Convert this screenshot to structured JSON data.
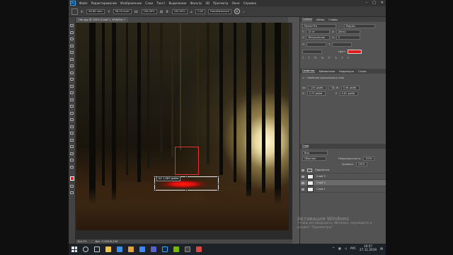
{
  "menu": {
    "items": [
      "Файл",
      "Редактирование",
      "Изображение",
      "Слои",
      "Текст",
      "Выделение",
      "Фильтр",
      "3D",
      "Просмотр",
      "Окно",
      "Справка"
    ]
  },
  "options": {
    "x": "48,86 пикс",
    "y": "96,04 пикс",
    "w": "100,00%",
    "h": "100,00%",
    "angle": "0,00",
    "interp": "Бикубическая"
  },
  "document": {
    "tab_label": "Лес.jpg @ 104% (Слой 1, RGB/8#) *"
  },
  "canvas": {
    "tooltip": "Ш: 1,083 дюйм"
  },
  "status": {
    "zoom": "104,7%",
    "doc": "Док: 3,43М/6,21М"
  },
  "character_panel": {
    "tabs": [
      "Символ",
      "Абзац",
      "Глифы"
    ],
    "font": "Myriad Pro",
    "style": "Regular",
    "size": "12 пт",
    "leading": "(Авто)",
    "tracking": "Метрические",
    "kerning": "0",
    "color_label": "Цвет:",
    "color": "#e21b1b"
  },
  "properties_panel": {
    "tabs": [
      "Свойства",
      "Библиотеки",
      "Коррекция",
      "Стили"
    ],
    "title": "Свойства пиксельного слоя",
    "w": "1,85 дюйм",
    "h": "0,46 дюйм",
    "x": "2,79 дюйм",
    "y": "0,81 дюйм",
    "link": "GO"
  },
  "layers_panel": {
    "tab": "Слои",
    "search": "Вид",
    "blend": "Обычные",
    "opacity_label": "Непрозрачность:",
    "opacity": "100%",
    "fill_label": "Заливка:",
    "fill": "100%",
    "layers": [
      "Подсветка",
      "Слой 3",
      "Слой 2",
      "Слой 1"
    ]
  },
  "watermark": {
    "line1": "Активация Windows",
    "line2": "Чтобы активировать Windows, перейдите в",
    "line3": "раздел \"Параметры\"."
  },
  "taskbar": {
    "lang": "РУС",
    "time": "19:57",
    "date": "27.11.2019"
  },
  "colors": {
    "accent": "#31a8ff",
    "glow": "#e21b1b"
  }
}
